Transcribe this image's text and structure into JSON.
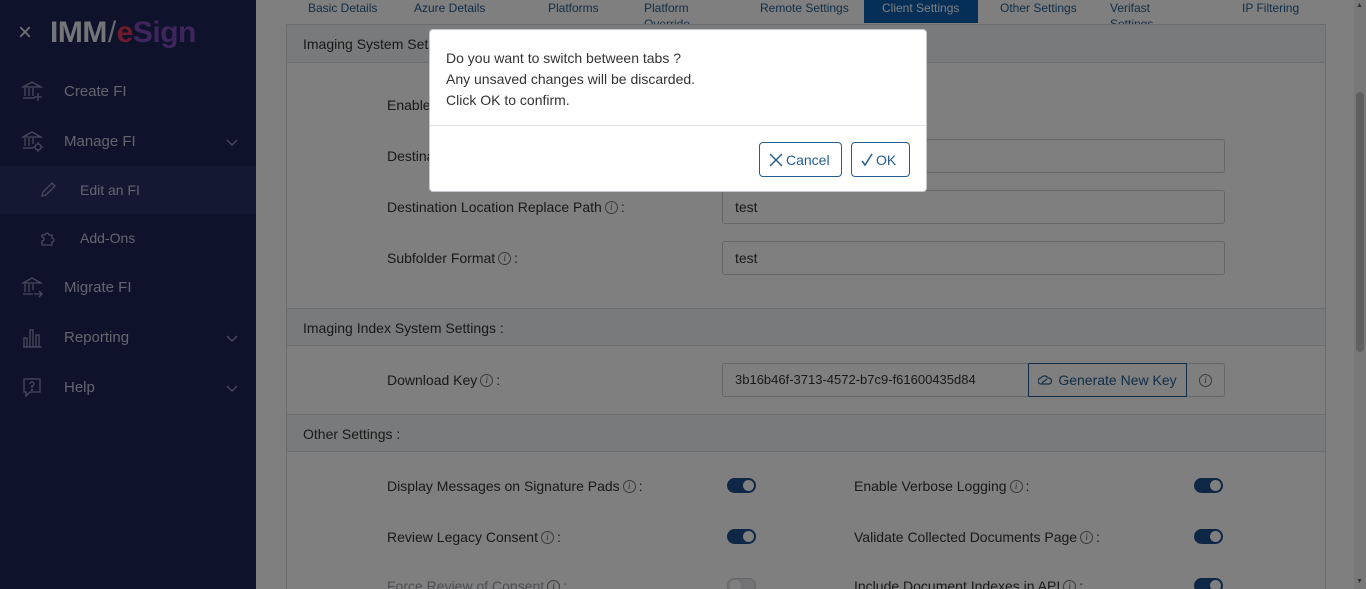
{
  "sidebar": {
    "brand": {
      "imm": "IMM",
      "slash": "/",
      "e": "e",
      "sign": "Sign"
    },
    "close_glyph": "×",
    "items": [
      {
        "label": "Create FI",
        "icon": "bank-plus-icon"
      },
      {
        "label": "Manage FI",
        "icon": "bank-gear-icon",
        "expandable": true
      },
      {
        "label": "Edit an FI",
        "icon": "pencil-icon",
        "sub": true,
        "active": true
      },
      {
        "label": "Add-Ons",
        "icon": "puzzle-icon",
        "sub": true
      },
      {
        "label": "Migrate FI",
        "icon": "bank-arrow-icon"
      },
      {
        "label": "Reporting",
        "icon": "bar-chart-icon",
        "expandable": true
      },
      {
        "label": "Help",
        "icon": "help-icon",
        "expandable": true
      }
    ]
  },
  "tabs": [
    "Basic Details",
    "Azure Details",
    "Platforms",
    "Platform Override",
    "Remote Settings",
    "Client Settings",
    "Other Settings",
    "Verifast Settings",
    "IP Filtering"
  ],
  "active_tab": "Client Settings",
  "sections": {
    "imaging_system": {
      "title": "Imaging System Settings :",
      "title_visible": "Imaging System Set",
      "fields": [
        {
          "label": "Enable",
          "value": ""
        },
        {
          "label": "Destina",
          "value": ""
        },
        {
          "label": "Destination Location Replace Path",
          "value": "test"
        },
        {
          "label": "Subfolder Format",
          "value": "test"
        }
      ]
    },
    "imaging_index": {
      "title": "Imaging Index System Settings :",
      "download_key_label": "Download Key",
      "download_key_value": "3b16b46f-3713-4572-b7c9-f61600435d84",
      "generate_label": "Generate New Key"
    },
    "other": {
      "title": "Other Settings :",
      "toggles": [
        {
          "label": "Display Messages on Signature Pads",
          "on": true
        },
        {
          "label": "Enable Verbose Logging",
          "on": true
        },
        {
          "label": "Review Legacy Consent",
          "on": true
        },
        {
          "label": "Validate Collected Documents Page",
          "on": true
        },
        {
          "label": "Force Review of Consent",
          "on": false
        },
        {
          "label": "Include Document Indexes in API",
          "on": true
        }
      ]
    }
  },
  "colon": ":",
  "modal": {
    "line1": "Do you want to switch between tabs ?",
    "line2": "Any unsaved changes will be discarded.",
    "line3": "Click OK to confirm.",
    "cancel_label": "Cancel",
    "ok_label": "OK"
  },
  "colors": {
    "sidebar_bg": "#1f2557",
    "accent": "#245d8f",
    "active_tab_bg": "#0b5fae",
    "toggle_on": "#1f4e8c"
  }
}
